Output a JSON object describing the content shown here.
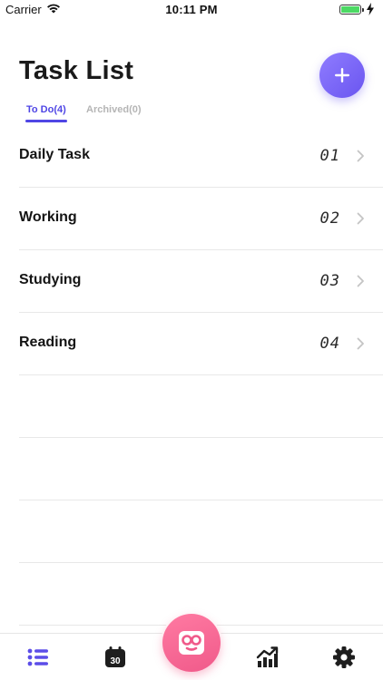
{
  "status_bar": {
    "carrier": "Carrier",
    "time": "10:11 PM",
    "battery_color": "#4cd964"
  },
  "header": {
    "title": "Task List",
    "add_icon": "plus-icon",
    "accent": "#6a55f0"
  },
  "tabs": [
    {
      "label": "To Do(4)",
      "active": true
    },
    {
      "label": "Archived(0)",
      "active": false
    }
  ],
  "tasks": [
    {
      "label": "Daily Task",
      "number": "01"
    },
    {
      "label": "Working",
      "number": "02"
    },
    {
      "label": "Studying",
      "number": "03"
    },
    {
      "label": "Reading",
      "number": "04"
    }
  ],
  "bottom_nav": {
    "items": [
      {
        "icon": "list-icon",
        "active": true
      },
      {
        "icon": "calendar-icon",
        "day": "30"
      },
      {
        "icon": "robot-face-icon",
        "center": true
      },
      {
        "icon": "chart-icon"
      },
      {
        "icon": "gear-icon"
      }
    ],
    "active_color": "#5b4de8",
    "center_color": "#f05a8a"
  }
}
